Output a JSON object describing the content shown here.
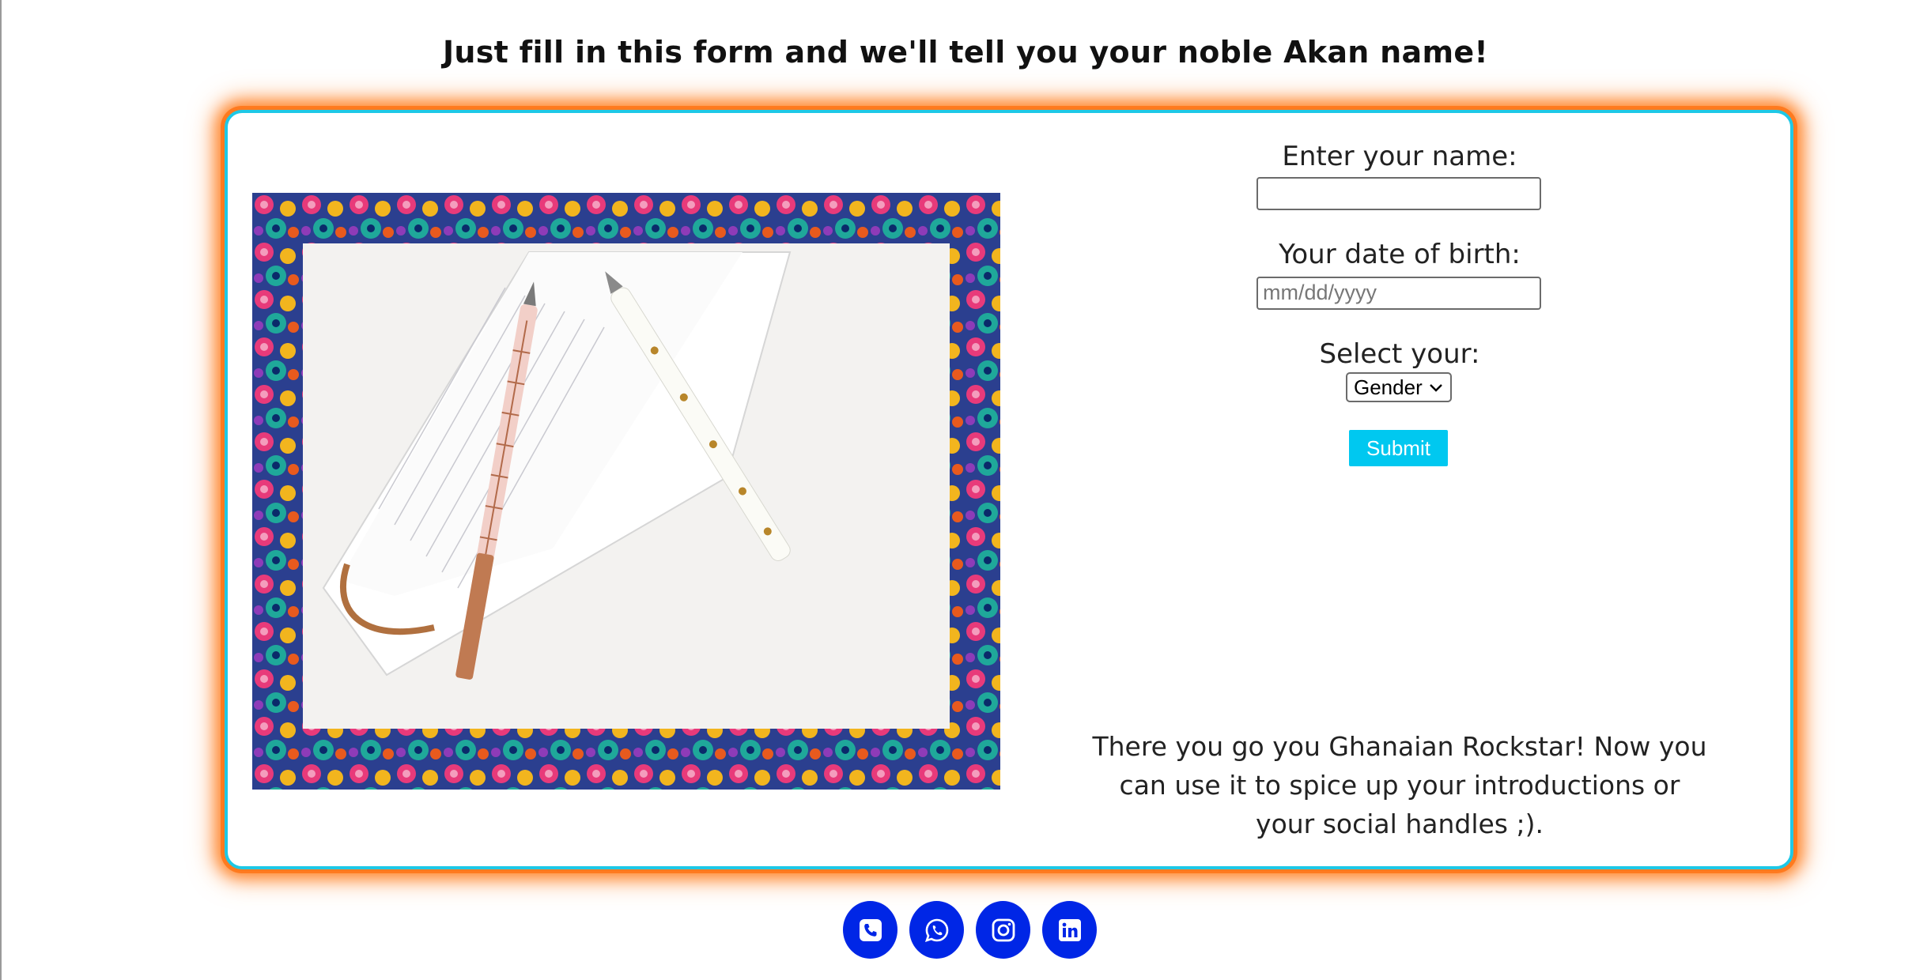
{
  "page": {
    "heading": "Just fill in this form and we'll tell you your noble Akan name!"
  },
  "form": {
    "name_label": "Enter your name:",
    "name_value": "",
    "dob_label": "Your date of birth:",
    "dob_placeholder": "mm/dd/yyyy",
    "select_label": "Select your:",
    "gender_selected": "Gender",
    "submit_label": "Submit"
  },
  "result_text": "There you go you Ghanaian Rockstar! Now you can use it to spice up your introductions or your social handles ;).",
  "socials": [
    {
      "icon": "phone-icon"
    },
    {
      "icon": "whatsapp-icon"
    },
    {
      "icon": "instagram-icon"
    },
    {
      "icon": "linkedin-icon"
    }
  ],
  "colors": {
    "card_border": "#1ec8e6",
    "card_glow": "#ff7a1f",
    "submit_bg": "#00c8f0",
    "social_bg": "#0026e6"
  }
}
